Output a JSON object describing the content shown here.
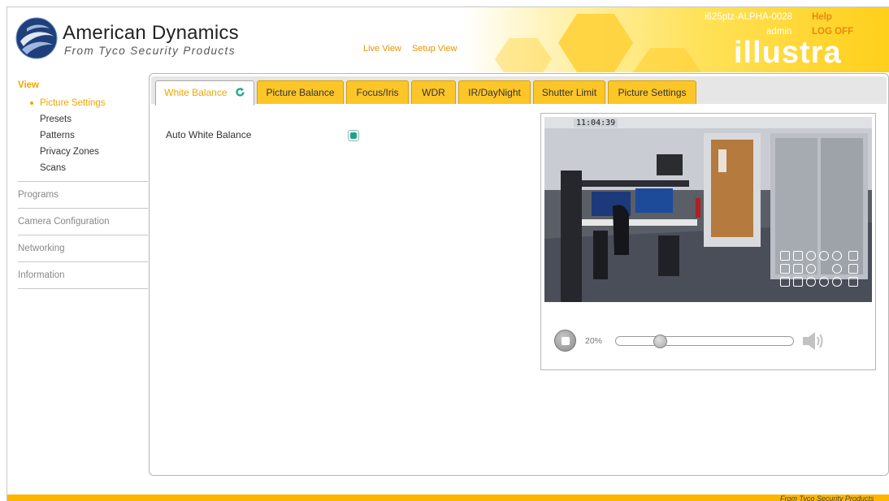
{
  "brand": {
    "name": "American Dynamics",
    "subtitle": "From Tyco Security Products",
    "product_logo": "illustra"
  },
  "header": {
    "nav": [
      "Live View",
      "Setup View"
    ],
    "device_name": "i625ptz-ALPHA-0028",
    "user": "admin",
    "help_label": "Help",
    "logoff_label": "LOG OFF"
  },
  "sidebar": {
    "section_view": "View",
    "view_items": [
      {
        "label": "Picture Settings",
        "active": true
      },
      {
        "label": "Presets",
        "active": false
      },
      {
        "label": "Patterns",
        "active": false
      },
      {
        "label": "Privacy Zones",
        "active": false
      },
      {
        "label": "Scans",
        "active": false
      }
    ],
    "sections": [
      "Programs",
      "Camera Configuration",
      "Networking",
      "Information"
    ]
  },
  "tabs": [
    {
      "label": "White Balance",
      "active": true
    },
    {
      "label": "Picture Balance",
      "active": false
    },
    {
      "label": "Focus/Iris",
      "active": false
    },
    {
      "label": "WDR",
      "active": false
    },
    {
      "label": "IR/DayNight",
      "active": false
    },
    {
      "label": "Shutter Limit",
      "active": false
    },
    {
      "label": "Picture Settings",
      "active": false
    }
  ],
  "white_balance": {
    "auto_label": "Auto White Balance",
    "auto_enabled": true
  },
  "video": {
    "timestamp": "11:04:39",
    "volume_percent_label": "20%",
    "volume_level": 0.2
  },
  "footer": {
    "text": "From Tyco Security Products"
  },
  "colors": {
    "accent": "#f0a500",
    "tab_bg": "#fcc628",
    "footer_bar": "#fbb700",
    "checkbox": "#1aa58a"
  },
  "icons": [
    "globe-logo-icon",
    "refresh-icon",
    "stop-icon",
    "speaker-icon"
  ]
}
